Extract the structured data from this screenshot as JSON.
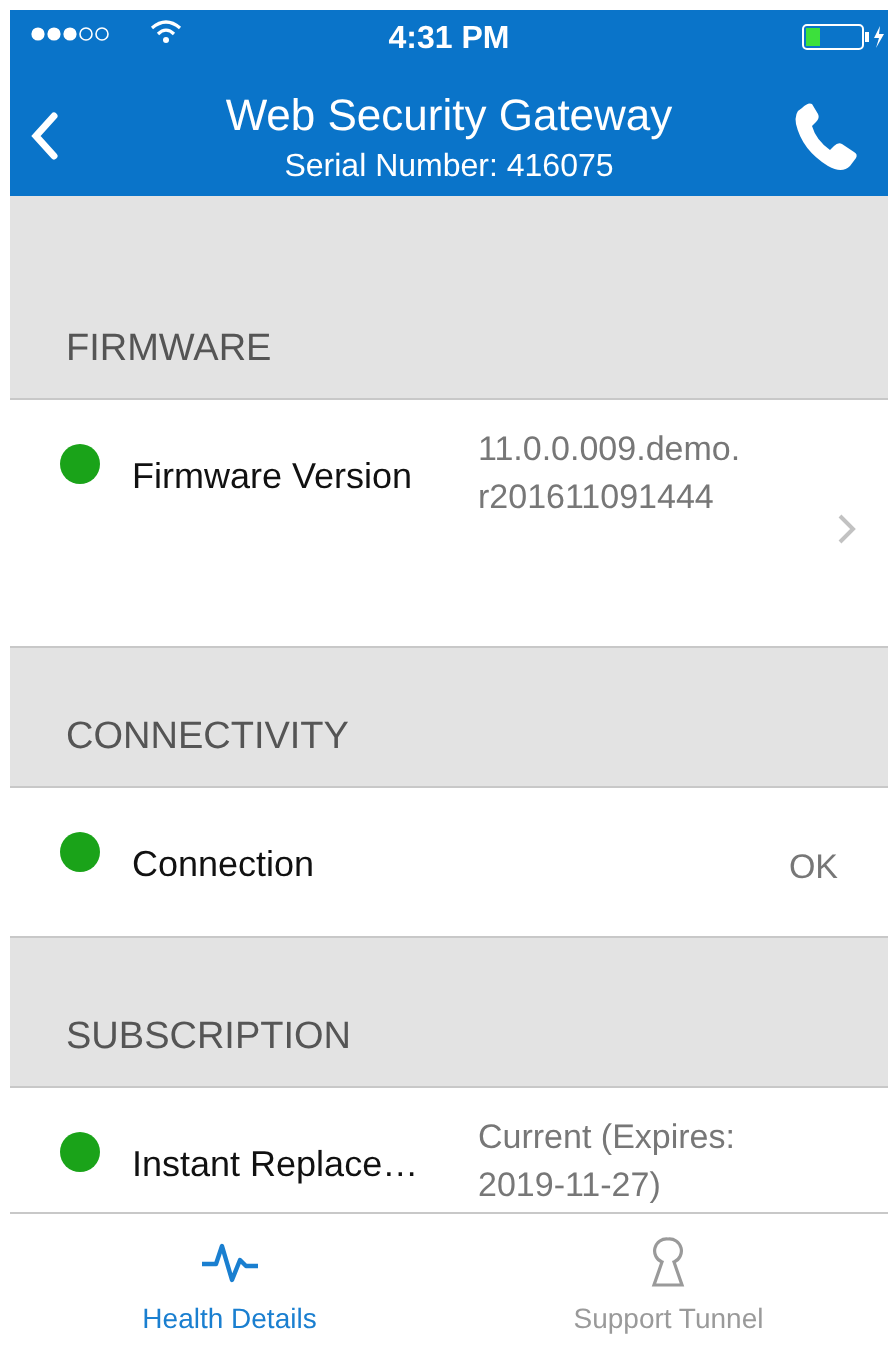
{
  "status_bar": {
    "time": "4:31 PM"
  },
  "nav_bar": {
    "title": "Web Security Gateway",
    "subtitle": "Serial Number: 416075"
  },
  "sections": [
    {
      "header": "FIRMWARE",
      "rows": [
        {
          "label": "Firmware Version",
          "value": "11.0.0.009.demo.r201611091444",
          "color": "#1aa319",
          "disclosure": true
        }
      ]
    },
    {
      "header": "CONNECTIVITY",
      "rows": [
        {
          "label": "Connection",
          "value": "OK",
          "color": "#1aa319",
          "disclosure": false
        }
      ]
    },
    {
      "header": "SUBSCRIPTION",
      "rows": [
        {
          "label": "Instant Replace…",
          "value": "Current (Expires: 2019-11-27)",
          "color": "#1aa319",
          "disclosure": false
        }
      ]
    }
  ],
  "tabs": [
    {
      "label": "Health Details",
      "kind": "health",
      "selected": true
    },
    {
      "label": "Support Tunnel",
      "kind": "tunnel",
      "selected": false
    }
  ]
}
